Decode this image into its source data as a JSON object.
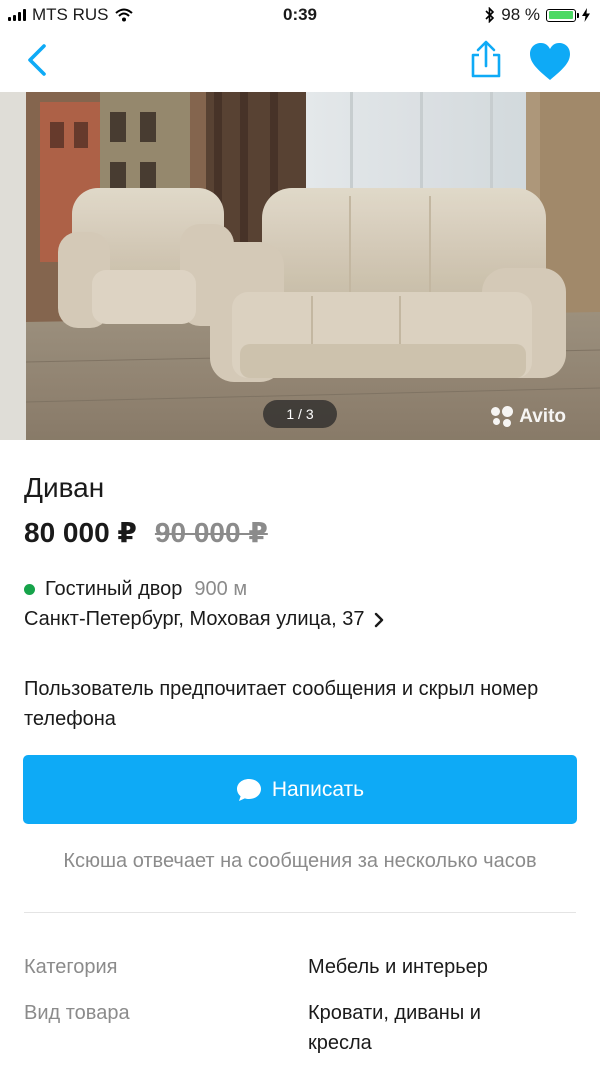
{
  "status_bar": {
    "carrier": "MTS RUS",
    "time": "0:39",
    "battery": "98 %",
    "icons": [
      "signal-icon",
      "wifi-icon",
      "bluetooth-icon",
      "battery-icon",
      "charging-icon"
    ]
  },
  "nav": {
    "back_icon": "chevron-left-icon",
    "share_icon": "share-icon",
    "favorite_icon": "heart-icon",
    "accent": "#0eaaf6"
  },
  "gallery": {
    "counter": "1 / 3",
    "watermark": "Avito"
  },
  "listing": {
    "title": "Диван",
    "price": "80 000 ₽",
    "old_price": "90 000 ₽"
  },
  "location": {
    "metro": "Гостиный двор",
    "metro_color": "#16a34a",
    "distance": "900 м",
    "address": "Санкт-Петербург, Моховая улица, 37"
  },
  "contact": {
    "notice": "Пользователь предпочитает сообщения и скрыл номер телефона",
    "button_label": "Написать",
    "button_icon": "chat-bubble-icon",
    "response_time": "Ксюша отвечает на сообщения за несколько часов"
  },
  "params": [
    {
      "label": "Категория",
      "value": "Мебель и интерьер"
    },
    {
      "label": "Вид товара",
      "value": "Кровати, диваны и кресла"
    }
  ]
}
